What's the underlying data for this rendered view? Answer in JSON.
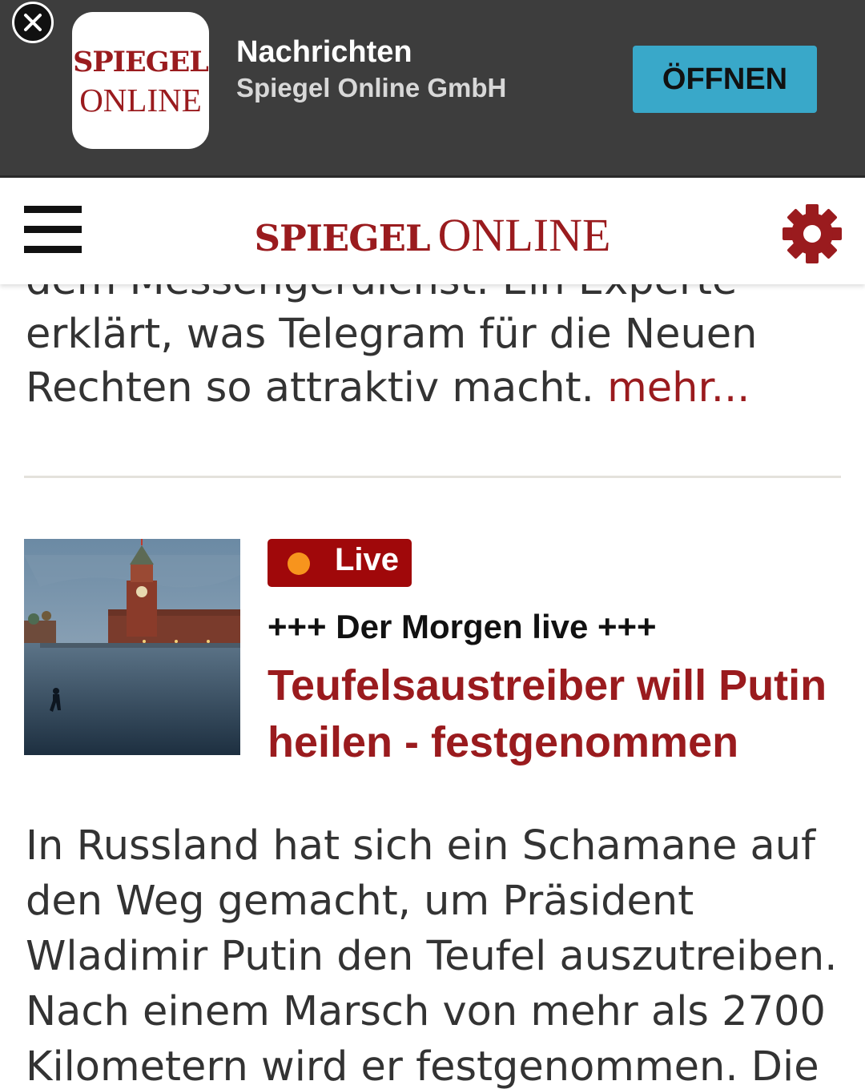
{
  "app_banner": {
    "close_label": "×",
    "icon_line1": "SPIEGEL",
    "icon_line2": "ONLINE",
    "app_name": "Nachrichten",
    "publisher": "Spiegel Online GmbH",
    "open_label": "ÖFFNEN",
    "open_color": "#39a8c9"
  },
  "header": {
    "logo_line1": "SPIEGEL",
    "logo_line2": "ONLINE",
    "menu_icon": "hamburger-menu-icon",
    "settings_icon": "gear-icon",
    "brand_color": "#9a1b1e"
  },
  "previous_article": {
    "text_line1": "dem Messengerdienst. Ein Experte",
    "text_rest": "erklärt, was Telegram für die Neuen Rechten so attraktiv macht. ",
    "more_label": "mehr..."
  },
  "article": {
    "badge": "Live",
    "kicker": "+++ Der Morgen live +++",
    "headline": "Teufelsaustreiber will Putin heilen - festgenommen",
    "teaser": "In Russland hat sich ein Schamane auf den Weg gemacht, um Präsident Wladimir Putin den Teufel auszutreiben. Nach einem Marsch von mehr als 2700 Kilometern wird er festgenommen. Die"
  }
}
